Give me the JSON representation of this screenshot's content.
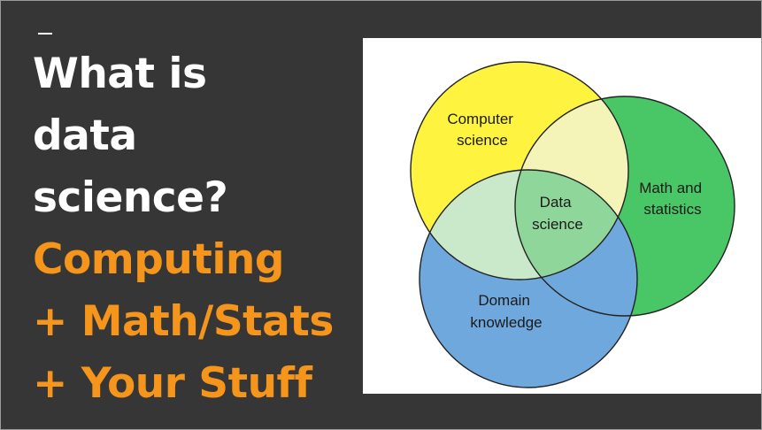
{
  "slide": {
    "title_lines": [
      "What is",
      "data",
      "science?"
    ],
    "subtitle_lines": [
      "Computing",
      "+ Math/Stats",
      "+ Your Stuff"
    ],
    "colors": {
      "background": "#363636",
      "title": "#ffffff",
      "highlight": "#f5951b"
    }
  },
  "venn": {
    "sets": {
      "computer_science": {
        "label_lines": [
          "Computer",
          "science"
        ],
        "color": "#fef33f"
      },
      "math_stats": {
        "label_lines": [
          "Math and",
          "statistics"
        ],
        "color": "#49c665"
      },
      "domain": {
        "label_lines": [
          "Domain",
          "knowledge"
        ],
        "color": "#6fa8dc"
      }
    },
    "center": {
      "label_lines": [
        "Data",
        "science"
      ],
      "color": "#8fd69a"
    },
    "overlap_colors": {
      "cs_math": "#f5f4b8",
      "cs_domain": "#c9e9ca"
    }
  }
}
